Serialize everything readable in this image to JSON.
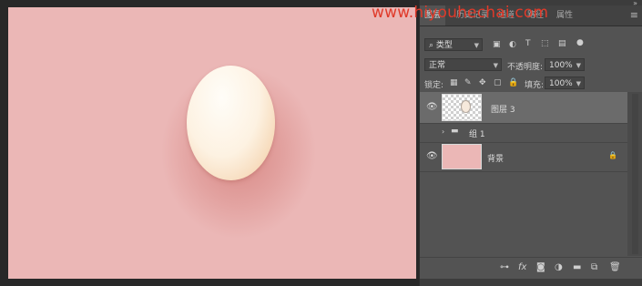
{
  "watermark": "www.hiyouhechai.com",
  "panel": {
    "tabs": [
      "图层",
      "历史记录",
      "通道",
      "路径",
      "属性"
    ],
    "filter_label": "类型",
    "blend_mode": "正常",
    "opacity_label": "不透明度:",
    "opacity_value": "100%",
    "lock_label": "锁定:",
    "fill_label": "填充:",
    "fill_value": "100%"
  },
  "layers": [
    {
      "name": "图层 3",
      "visible": true,
      "selected": true,
      "type": "pixel"
    },
    {
      "name": "组 1",
      "visible": false,
      "selected": false,
      "type": "group"
    },
    {
      "name": "背景",
      "visible": true,
      "selected": false,
      "type": "background",
      "locked": true
    }
  ],
  "colors": {
    "canvas_bg": "#ebb7b6",
    "panel_bg": "#535353",
    "selected_row": "#6b6b6b",
    "watermark": "#e03a2a"
  },
  "icons": {
    "panel_menu": "menu-lines-icon",
    "eye": "eye-icon",
    "folder": "folder-icon",
    "lock": "lock-icon",
    "link": "link-icon",
    "fx": "fx-icon",
    "mask": "mask-icon",
    "adjustment": "adjustment-icon",
    "new_group": "folder-icon",
    "new_layer": "new-layer-icon",
    "delete": "trash-icon"
  }
}
